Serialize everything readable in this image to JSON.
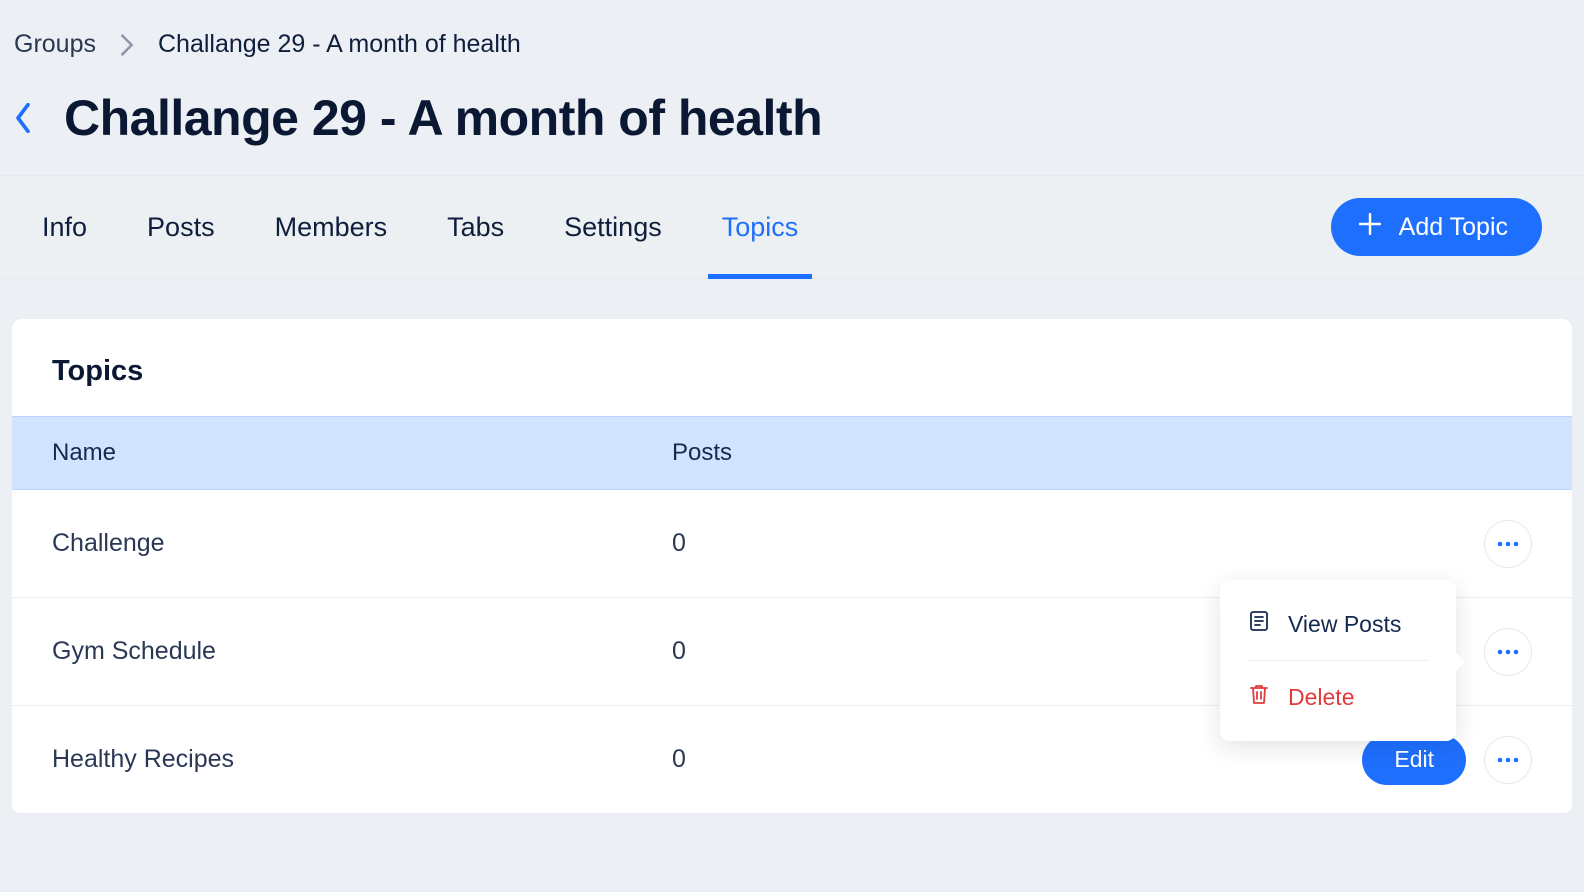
{
  "breadcrumb": {
    "root": "Groups",
    "current": "Challange 29 - A month of health"
  },
  "page": {
    "title": "Challange 29 - A month of health"
  },
  "tabs": [
    {
      "label": "Info"
    },
    {
      "label": "Posts"
    },
    {
      "label": "Members"
    },
    {
      "label": "Tabs"
    },
    {
      "label": "Settings"
    },
    {
      "label": "Topics",
      "active": true
    }
  ],
  "actions": {
    "add_topic": "Add Topic",
    "edit": "Edit"
  },
  "card": {
    "title": "Topics",
    "columns": {
      "name": "Name",
      "posts": "Posts"
    },
    "rows": [
      {
        "name": "Challenge",
        "posts": "0"
      },
      {
        "name": "Gym Schedule",
        "posts": "0"
      },
      {
        "name": "Healthy Recipes",
        "posts": "0"
      }
    ]
  },
  "popover": {
    "view_posts": "View Posts",
    "delete": "Delete"
  }
}
